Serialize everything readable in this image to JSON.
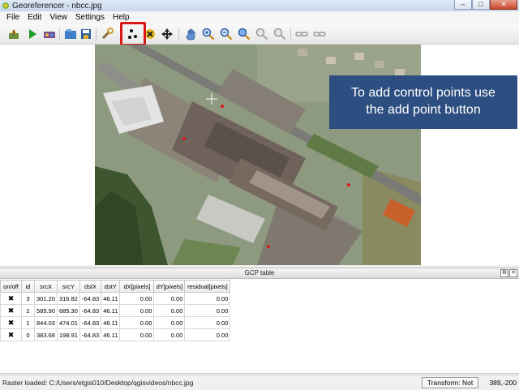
{
  "window": {
    "title": "Georeferencer - nbcc.jpg",
    "minimize": "–",
    "maximize": "□",
    "close": "✕"
  },
  "menu": [
    "File",
    "Edit",
    "View",
    "Settings",
    "Help"
  ],
  "toolbar": {
    "icons": [
      "open-raster-icon",
      "start-georeferencing-icon",
      "generate-gdal-script-icon",
      "load-gcp-points-icon",
      "save-gcp-points-icon",
      "transformation-settings-icon",
      "add-point-icon",
      "delete-point-icon",
      "move-gcp-point-icon",
      "pan-icon",
      "zoom-in-icon",
      "zoom-out-icon",
      "zoom-to-layer-icon",
      "zoom-last-icon",
      "zoom-next-icon",
      "link-georeferencer-to-qgis-icon",
      "link-qgis-to-georeferencer-icon"
    ],
    "highlighted": "add-point-icon"
  },
  "tooltip": {
    "line1": "To add control points use",
    "line2": "the add point button"
  },
  "gcp_table": {
    "title": "GCP table",
    "float_button": "⧉",
    "close_button": "✕",
    "columns": [
      "on/off",
      "id",
      "srcX",
      "srcY",
      "dstX",
      "dstY",
      "dX[pixels]",
      "dY[pixels]",
      "residual[pixels]"
    ],
    "rows": [
      {
        "check": "✖",
        "id": "3",
        "srcX": "301.20",
        "srcY": "316.82",
        "dstX": "-64.83",
        "dstY": "46.11",
        "dX": "0.00",
        "dY": "0.00",
        "residual": "0.00"
      },
      {
        "check": "✖",
        "id": "2",
        "srcX": "585.90",
        "srcY": "685.30",
        "dstX": "-64.83",
        "dstY": "46.11",
        "dX": "0.00",
        "dY": "0.00",
        "residual": "0.00"
      },
      {
        "check": "✖",
        "id": "1",
        "srcX": "844.03",
        "srcY": "474.01",
        "dstX": "-64.83",
        "dstY": "46.11",
        "dX": "0.00",
        "dY": "0.00",
        "residual": "0.00"
      },
      {
        "check": "✖",
        "id": "0",
        "srcX": "383.68",
        "srcY": "198.91",
        "dstX": "-64.83",
        "dstY": "46.11",
        "dX": "0.00",
        "dY": "0.00",
        "residual": "0.00"
      }
    ]
  },
  "status": {
    "raster_loaded": "Raster loaded: C:/Users/etgis010/Desktop/qgisvideos/nbcc.jpg",
    "transform": "Transform: Not set",
    "coordinates": "389,-200"
  },
  "colors": {
    "highlight": "#d81818",
    "tooltip_bg": "#2d4e80"
  }
}
